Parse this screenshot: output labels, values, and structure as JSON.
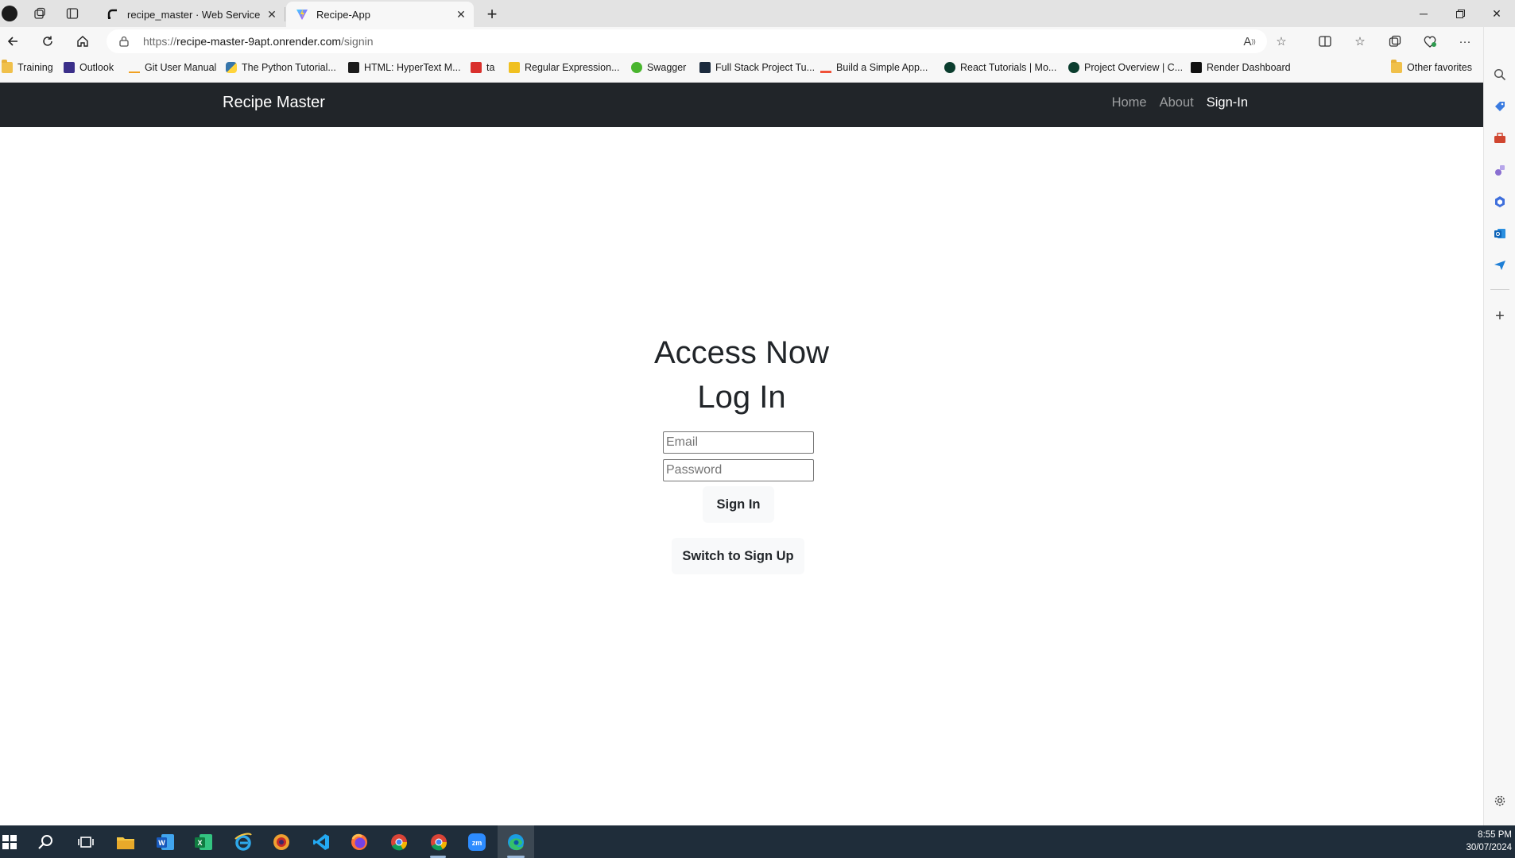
{
  "browser": {
    "tabs": [
      {
        "title": "recipe_master · Web Service · Re",
        "icon": "render-icon"
      },
      {
        "title": "Recipe-App",
        "icon": "vite-icon"
      }
    ],
    "url": {
      "scheme": "https://",
      "host": "recipe-master-9apt.onrender.com",
      "path": "/signin"
    },
    "favorites": [
      {
        "label": "Training",
        "icon": "folder-icon"
      },
      {
        "label": "Outlook",
        "icon": "outlook-icon"
      },
      {
        "label": "Git User Manual",
        "icon": "git-icon"
      },
      {
        "label": "The Python Tutorial...",
        "icon": "python-icon"
      },
      {
        "label": "HTML: HyperText M...",
        "icon": "mdn-icon"
      },
      {
        "label": "ta",
        "icon": "pdf-icon"
      },
      {
        "label": "Regular Expression...",
        "icon": "js-icon"
      },
      {
        "label": "Swagger",
        "icon": "swagger-icon"
      },
      {
        "label": "Full Stack Project Tu...",
        "icon": "project-icon"
      },
      {
        "label": "Build a Simple App...",
        "icon": "swift-icon"
      },
      {
        "label": "React Tutorials | Mo...",
        "icon": "mongodb-icon"
      },
      {
        "label": "Project Overview | C...",
        "icon": "mongodb-icon"
      },
      {
        "label": "Render Dashboard",
        "icon": "render-icon"
      }
    ],
    "other_favorites": "Other favorites"
  },
  "app": {
    "brand": "Recipe Master",
    "nav": [
      "Home",
      "About",
      "Sign-In"
    ],
    "heading_1": "Access Now",
    "heading_2": "Log In",
    "email_placeholder": "Email",
    "password_placeholder": "Password",
    "sign_in_button": "Sign In",
    "switch_button": "Switch to Sign Up"
  },
  "taskbar": {
    "time": "8:55 PM",
    "date": "30/07/2024"
  },
  "colors": {
    "navbar_bg": "#212529",
    "taskbar_bg": "#1f2d3a",
    "button_bg": "#f8f9fa"
  }
}
